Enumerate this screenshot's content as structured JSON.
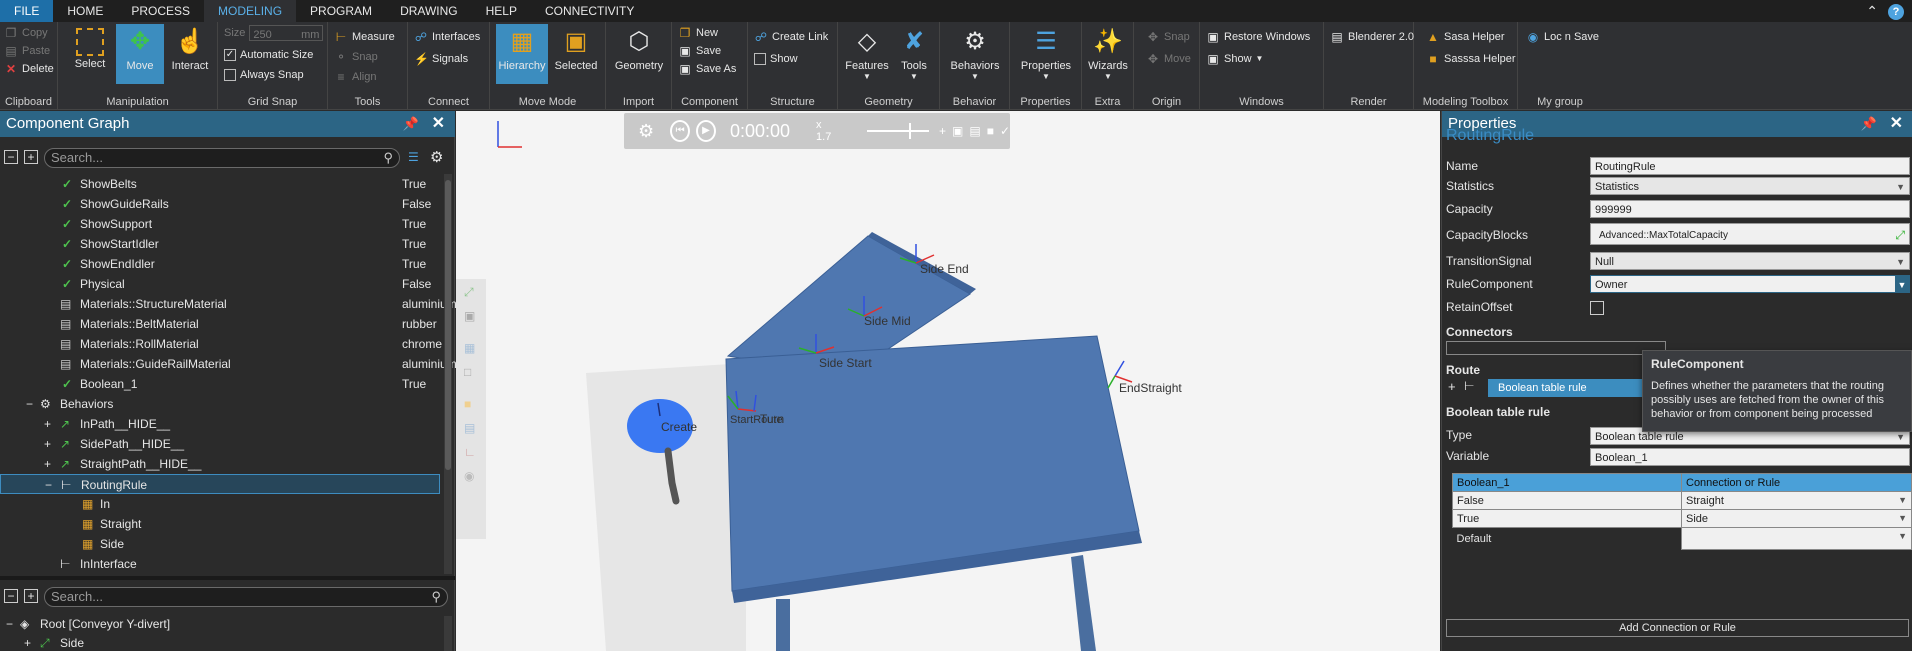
{
  "menu": {
    "items": [
      "FILE",
      "HOME",
      "PROCESS",
      "MODELING",
      "PROGRAM",
      "DRAWING",
      "HELP",
      "CONNECTIVITY"
    ],
    "active": "MODELING"
  },
  "ribbon": {
    "clipboard": {
      "label": "Clipboard",
      "copy": "Copy",
      "paste": "Paste",
      "delete": "Delete"
    },
    "manipulation": {
      "label": "Manipulation",
      "select": "Select",
      "move": "Move",
      "interact": "Interact"
    },
    "grid_snap": {
      "label": "Grid Snap",
      "size_label": "Size",
      "size_value": "250",
      "size_unit": "mm",
      "auto_size": "Automatic Size",
      "always_snap": "Always Snap"
    },
    "tools": {
      "label": "Tools",
      "measure": "Measure",
      "snap": "Snap",
      "align": "Align"
    },
    "connect": {
      "label": "Connect",
      "interfaces": "Interfaces",
      "signals": "Signals"
    },
    "move_mode": {
      "label": "Move Mode",
      "hierarchy": "Hierarchy",
      "selected": "Selected"
    },
    "import": {
      "label": "Import",
      "geometry": "Geometry"
    },
    "component": {
      "label": "Component",
      "new": "New",
      "save": "Save",
      "save_as": "Save As"
    },
    "structure": {
      "label": "Structure",
      "create_link": "Create Link",
      "show": "Show"
    },
    "geometry": {
      "label": "Geometry",
      "features": "Features",
      "tools": "Tools"
    },
    "behavior": {
      "label": "Behavior",
      "behaviors": "Behaviors"
    },
    "properties": {
      "label": "Properties",
      "properties": "Properties"
    },
    "extra": {
      "label": "Extra",
      "wizards": "Wizards"
    },
    "origin": {
      "label": "Origin",
      "snap": "Snap",
      "move": "Move"
    },
    "windows": {
      "label": "Windows",
      "restore": "Restore Windows",
      "show": "Show"
    },
    "render": {
      "label": "Render",
      "blenderer": "Blenderer 2.0"
    },
    "modeling_toolbox": {
      "label": "Modeling Toolbox",
      "sasa": "Sasa Helper",
      "sasssa": "Sasssa Helper"
    },
    "my_group": {
      "label": "My group",
      "loc_n_save": "Loc n Save"
    }
  },
  "component_graph": {
    "title": "Component Graph",
    "search_placeholder": "Search...",
    "rows": [
      {
        "label": "ShowBelts",
        "value": "True",
        "icon": "check"
      },
      {
        "label": "ShowGuideRails",
        "value": "False",
        "icon": "check"
      },
      {
        "label": "ShowSupport",
        "value": "True",
        "icon": "check"
      },
      {
        "label": "ShowStartIdler",
        "value": "True",
        "icon": "check"
      },
      {
        "label": "ShowEndIdler",
        "value": "True",
        "icon": "check"
      },
      {
        "label": "Physical",
        "value": "False",
        "icon": "check"
      },
      {
        "label": "Materials::StructureMaterial",
        "value": "aluminium",
        "icon": "material"
      },
      {
        "label": "Materials::BeltMaterial",
        "value": "rubber",
        "icon": "material"
      },
      {
        "label": "Materials::RollMaterial",
        "value": "chrome",
        "icon": "material"
      },
      {
        "label": "Materials::GuideRailMaterial",
        "value": "aluminium",
        "icon": "material"
      },
      {
        "label": "Boolean_1",
        "value": "True",
        "icon": "check"
      }
    ],
    "behaviors_label": "Behaviors",
    "behavior_rows": [
      "InPath__HIDE__",
      "SidePath__HIDE__",
      "StraightPath__HIDE__"
    ],
    "routing_rule": "RoutingRule",
    "routing_children": [
      "In",
      "Straight",
      "Side"
    ],
    "in_interface": "InInterface",
    "root_label": "Root [Conveyor Y-divert]",
    "root_child": "Side"
  },
  "viewport": {
    "time": "0:00:00",
    "speed": "x 1.7",
    "labels": {
      "side_end": "Side End",
      "side_mid": "Side Mid",
      "side_start": "Side Start",
      "end_straight": "EndStraight",
      "create": "Create",
      "turn": "Turn",
      "start_route": "StartRoute"
    }
  },
  "properties": {
    "title": "Properties",
    "heading": "RoutingRule",
    "fields": [
      {
        "label": "Name",
        "value": "RoutingRule",
        "dropdown": false
      },
      {
        "label": "Statistics",
        "value": "Statistics",
        "dropdown": true
      },
      {
        "label": "Capacity",
        "value": "999999",
        "dropdown": false
      },
      {
        "label": "CapacityBlocks",
        "value": "Advanced::MaxTotalCapacity",
        "dropdown": false
      },
      {
        "label": "TransitionSignal",
        "value": "Null",
        "dropdown": true
      },
      {
        "label": "RuleComponent",
        "value": "Owner",
        "dropdown": true
      }
    ],
    "retain_offset": "RetainOffset",
    "connectors": "Connectors",
    "route": "Route",
    "route_chip": "Boolean table rule",
    "btr_heading": "Boolean table rule",
    "type_label": "Type",
    "type_value": "Boolean table rule",
    "variable_label": "Variable",
    "variable_value": "Boolean_1",
    "table": {
      "headers": [
        "Boolean_1",
        "Connection or Rule"
      ],
      "rows": [
        [
          "False",
          "Straight"
        ],
        [
          "True",
          "Side"
        ]
      ],
      "default_label": "Default"
    },
    "add_button": "Add Connection or Rule",
    "tooltip": {
      "title": "RuleComponent",
      "text": "Defines whether the parameters that the routing possibly uses are fetched from the owner of this behavior or from component being processed"
    }
  },
  "colors": {
    "accent": "#2c6585",
    "conveyor": "#4f77b0",
    "file": "#1e6fa8"
  }
}
